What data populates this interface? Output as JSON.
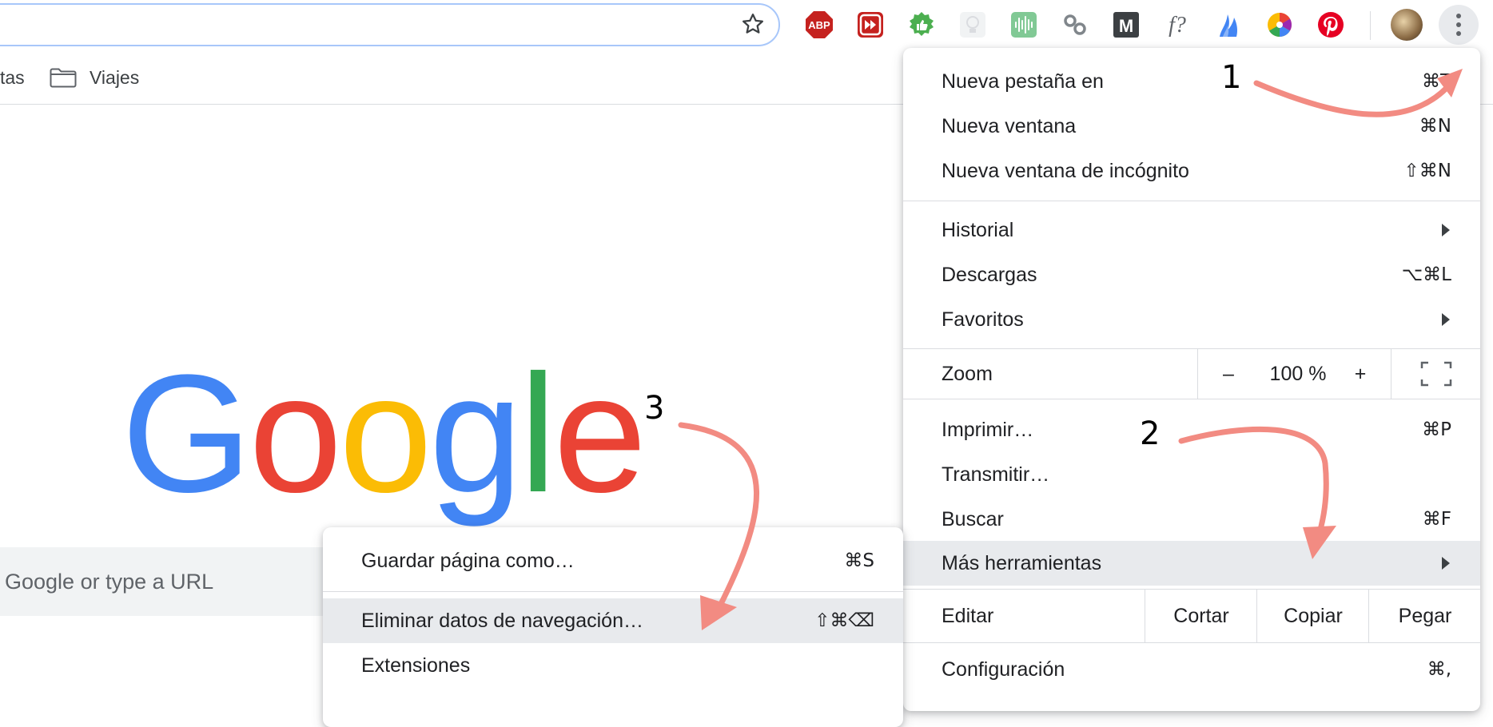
{
  "bookmarks": {
    "items": [
      {
        "label": "tas"
      },
      {
        "label": "Viajes"
      }
    ]
  },
  "ntp": {
    "logo": [
      "G",
      "o",
      "o",
      "g",
      "l",
      "e"
    ],
    "logo_colors": [
      "#4285F4",
      "#EA4335",
      "#FBBC05",
      "#4285F4",
      "#34A853",
      "#EA4335"
    ],
    "search_placeholder": "Google or type a URL"
  },
  "extensions": [
    "adblock-plus-icon",
    "fast-forward-icon",
    "thumbs-up-icon",
    "lightbulb-icon",
    "audio-wave-icon",
    "link-icon",
    "m-logo-icon",
    "font-question-icon",
    "flame-icon",
    "color-wheel-icon",
    "pinterest-icon"
  ],
  "extension_labels": {
    "abp": "ABP",
    "m": "M",
    "font_q": "f?"
  },
  "main_menu": {
    "items": [
      {
        "label": "Nueva pestaña en",
        "shortcut": "⌘T"
      },
      {
        "label": "Nueva ventana",
        "shortcut": "⌘N"
      },
      {
        "label": "Nueva ventana de incógnito",
        "shortcut": "⇧⌘N"
      },
      {
        "label": "Historial",
        "shortcut": ""
      },
      {
        "label": "Descargas",
        "shortcut": "⌥⌘L"
      },
      {
        "label": "Favoritos",
        "shortcut": ""
      },
      {
        "label": "Imprimir…",
        "shortcut": "⌘P"
      },
      {
        "label": "Transmitir…",
        "shortcut": ""
      },
      {
        "label": "Buscar",
        "shortcut": "⌘F"
      },
      {
        "label": "Más herramientas",
        "shortcut": ""
      },
      {
        "label": "Configuración",
        "shortcut": "⌘,"
      }
    ],
    "zoom": {
      "label": "Zoom",
      "minus": "–",
      "value": "100 %",
      "plus": "+"
    },
    "edit": {
      "label": "Editar",
      "cut": "Cortar",
      "copy": "Copiar",
      "paste": "Pegar"
    }
  },
  "sub_menu": {
    "items": [
      {
        "label": "Guardar página como…",
        "shortcut": "⌘S"
      },
      {
        "label": "Eliminar datos de navegación…",
        "shortcut": "⇧⌘⌫"
      },
      {
        "label": "Extensiones",
        "shortcut": ""
      }
    ]
  },
  "annotations": {
    "step1": "1",
    "step2": "2",
    "step3": "3",
    "arrow_color": "#F28B82"
  }
}
